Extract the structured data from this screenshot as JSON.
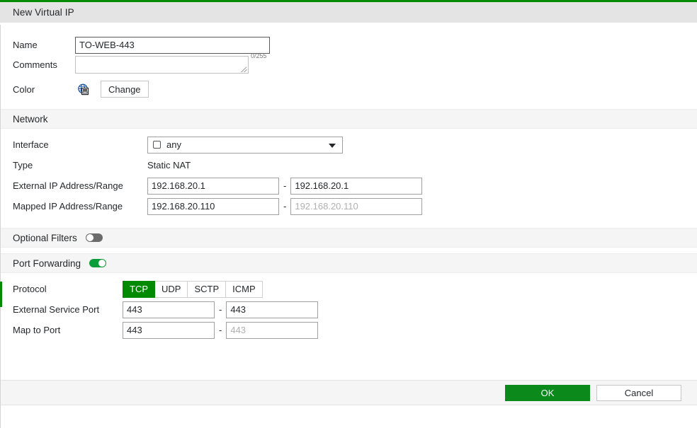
{
  "dialog": {
    "title": "New Virtual IP",
    "accent_color": "#008a00"
  },
  "general": {
    "name_label": "Name",
    "name_value": "TO-WEB-443",
    "comments_label": "Comments",
    "comments_value": "",
    "comments_counter": "0/255",
    "color_label": "Color",
    "color_icon": "globe-server-icon",
    "change_button": "Change"
  },
  "network": {
    "section_label": "Network",
    "interface_label": "Interface",
    "interface_value": "any",
    "type_label": "Type",
    "type_value": "Static NAT",
    "external_ip_label": "External IP Address/Range",
    "external_ip_start": "192.168.20.1",
    "external_ip_end": "192.168.20.1",
    "mapped_ip_label": "Mapped IP Address/Range",
    "mapped_ip_start": "192.168.20.110",
    "mapped_ip_end_placeholder": "192.168.20.110",
    "range_separator": "-"
  },
  "optional_filters": {
    "section_label": "Optional Filters",
    "enabled": false
  },
  "port_forwarding": {
    "section_label": "Port Forwarding",
    "enabled": true,
    "protocol_label": "Protocol",
    "protocols": [
      "TCP",
      "UDP",
      "SCTP",
      "ICMP"
    ],
    "protocol_selected": "TCP",
    "external_service_port_label": "External Service Port",
    "external_service_port_start": "443",
    "external_service_port_end": "443",
    "map_to_port_label": "Map to Port",
    "map_to_port_start": "443",
    "map_to_port_end_placeholder": "443",
    "range_separator": "-"
  },
  "footer": {
    "ok_label": "OK",
    "cancel_label": "Cancel"
  }
}
